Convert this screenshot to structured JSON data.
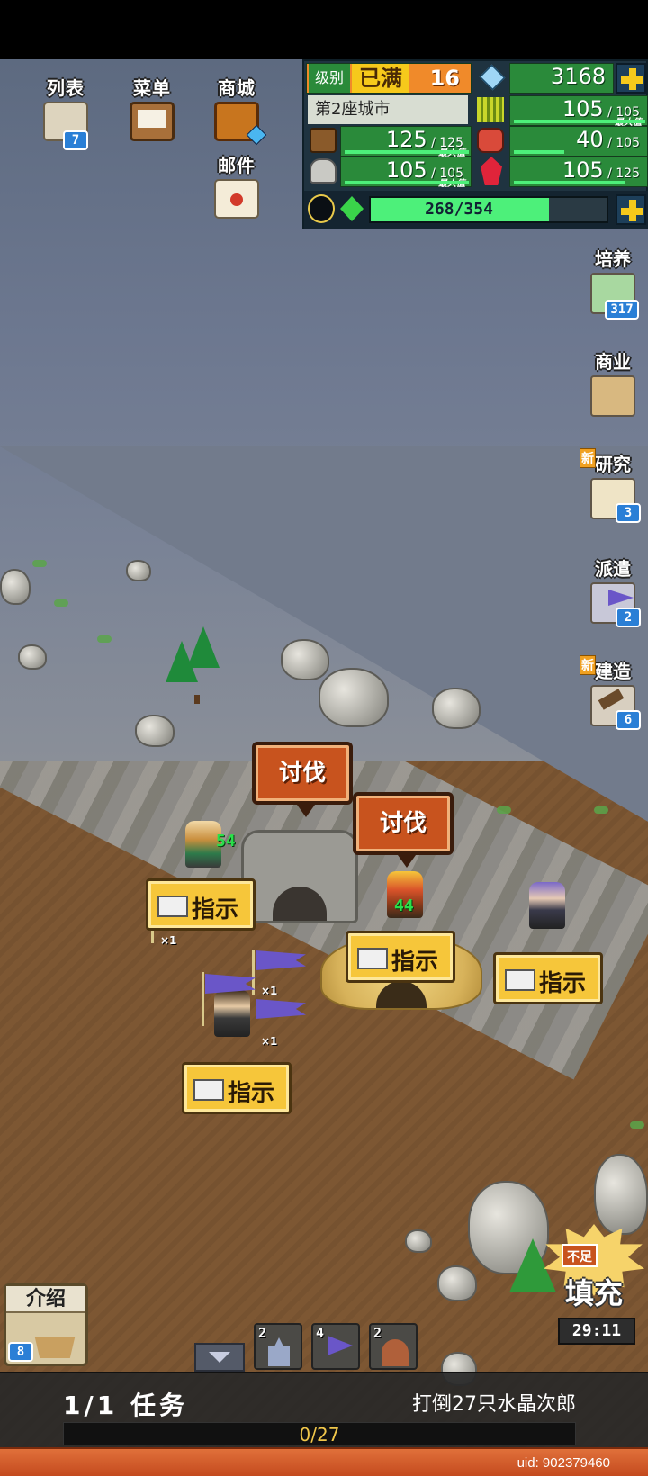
{
  "menu": {
    "list_label": "列表",
    "list_badge": "7",
    "menu_label": "菜单",
    "shop_label": "商城",
    "mail_label": "邮件"
  },
  "resources": {
    "level_label": "级别",
    "level_status": "已满",
    "level_value": "16",
    "gems": "3168",
    "city_name": "第2座城市",
    "food_value": "105",
    "food_max": "105",
    "food_max_tag": "最大值",
    "wood_value": "125",
    "wood_max": "125",
    "wood_max_tag": "最大值",
    "meat_value": "40",
    "meat_max": "105",
    "stone_value": "105",
    "stone_max": "105",
    "stone_max_tag": "最大值",
    "crystal_value": "105",
    "crystal_max": "125",
    "energy_value": "268",
    "energy_max": "354",
    "energy_fraction": 0.757
  },
  "right_menu": [
    {
      "label": "培养",
      "badge": "317",
      "icon": "train-icon",
      "new": false
    },
    {
      "label": "商业",
      "badge": "",
      "icon": "shop-house-icon",
      "new": false
    },
    {
      "label": "研究",
      "badge": "3",
      "icon": "scroll-icon",
      "new": true
    },
    {
      "label": "派遣",
      "badge": "2",
      "icon": "flag-icon",
      "new": false
    },
    {
      "label": "建造",
      "badge": "6",
      "icon": "hammer-icon",
      "new": true
    }
  ],
  "new_tag": "新",
  "map": {
    "attack_label": "讨伐",
    "instruct_label": "指示",
    "unit_levels": [
      "54",
      "44"
    ],
    "flag_count": "×1"
  },
  "fill": {
    "cap": "不足",
    "label": "填充",
    "timer": "29:11"
  },
  "intro": {
    "label": "介绍",
    "badge": "8"
  },
  "chips": [
    {
      "count": "2",
      "icon": "castle-icon"
    },
    {
      "count": "4",
      "icon": "purple-flag-icon"
    },
    {
      "count": "2",
      "icon": "cave-icon"
    }
  ],
  "mission": {
    "progress": "1/1 任务",
    "description": "打倒27只水晶次郎",
    "count": "0/27",
    "count_fraction": 0.0
  },
  "footer": {
    "uid": "uid: 902379460"
  },
  "colors": {
    "panel_green": "#2a8a3a",
    "accent_yellow": "#f6c91b",
    "attack_orange": "#c8531e",
    "instruct_yellow": "#f6c63a"
  }
}
